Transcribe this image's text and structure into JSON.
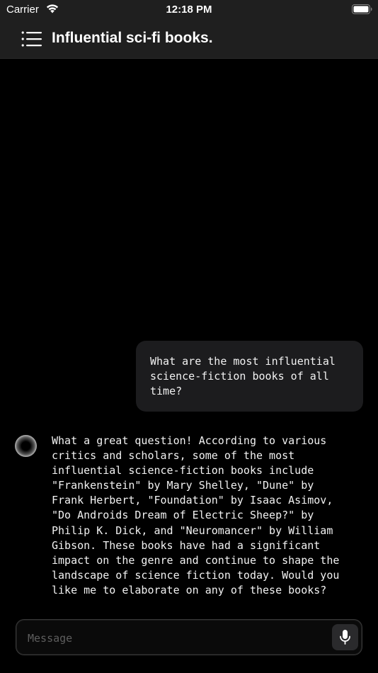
{
  "status_bar": {
    "carrier": "Carrier",
    "time": "12:18 PM",
    "wifi_icon": "wifi-icon",
    "battery_icon": "battery-icon"
  },
  "header": {
    "menu_icon": "hamburger-menu-icon",
    "title": "Influential sci-fi books."
  },
  "conversation": {
    "messages": [
      {
        "role": "user",
        "text": "What are the most influential\nscience-fiction books of all\ntime?"
      },
      {
        "role": "assistant",
        "text": "What a great question! According to various\ncritics and scholars, some of the most\ninfluential science-fiction books include\n\"Frankenstein\" by Mary Shelley, \"Dune\" by\nFrank Herbert, \"Foundation\" by Isaac Asimov,\n\"Do Androids Dream of Electric Sheep?\" by\nPhilip K. Dick, and \"Neuromancer\" by William\nGibson. These books have had a significant\nimpact on the genre and continue to shape the\nlandscape of science fiction today. Would you\nlike me to elaborate on any of these books?"
      }
    ]
  },
  "composer": {
    "placeholder": "Message",
    "value": "",
    "mic_icon": "microphone-icon"
  },
  "colors": {
    "background": "#000000",
    "bar": "#1f1f1f",
    "user_bubble": "#1c1c1e",
    "text": "#f2f2f2",
    "placeholder": "#5e5e5e"
  }
}
